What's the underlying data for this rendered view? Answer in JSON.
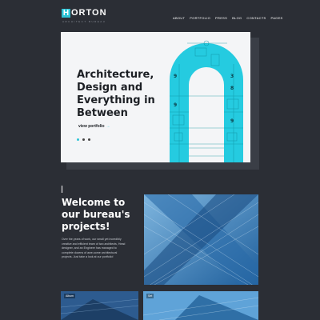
{
  "header": {
    "logo_mark": "H",
    "logo_rest": "ORTON",
    "tagline": "ARCHITECT BUREAU",
    "nav": [
      "ABOUT",
      "PORTFOLIO",
      "PRESS",
      "BLOG",
      "CONTACTS",
      "PAGES"
    ]
  },
  "hero": {
    "title": "Architecture,\nDesign and\nEverything in\nBetween",
    "link": "view portfolio",
    "accent_color": "#2ec4d6",
    "slides_count": 3,
    "active_slide": 1
  },
  "welcome": {
    "title_bold": "Welcome",
    "title_rest": " to our bureau's projects!",
    "text": "Over the years of work, our small yet incredibly creative and efficient team of two architects, Head designer, and an Engineer has managed to complete dozens of awe-some architectural projects. Just take a look at our portfolio!"
  },
  "gallery": {
    "tags": [
      "Album",
      "Set"
    ]
  }
}
